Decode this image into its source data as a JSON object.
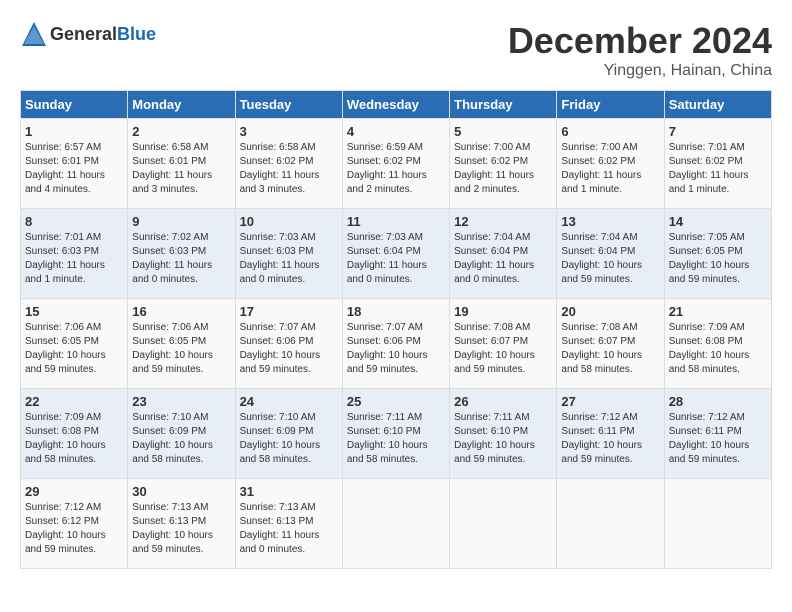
{
  "header": {
    "logo_general": "General",
    "logo_blue": "Blue",
    "title": "December 2024",
    "location": "Yinggen, Hainan, China"
  },
  "days_of_week": [
    "Sunday",
    "Monday",
    "Tuesday",
    "Wednesday",
    "Thursday",
    "Friday",
    "Saturday"
  ],
  "weeks": [
    [
      {
        "day": "1",
        "sunrise": "6:57 AM",
        "sunset": "6:01 PM",
        "daylight": "11 hours and 4 minutes."
      },
      {
        "day": "2",
        "sunrise": "6:58 AM",
        "sunset": "6:01 PM",
        "daylight": "11 hours and 3 minutes."
      },
      {
        "day": "3",
        "sunrise": "6:58 AM",
        "sunset": "6:02 PM",
        "daylight": "11 hours and 3 minutes."
      },
      {
        "day": "4",
        "sunrise": "6:59 AM",
        "sunset": "6:02 PM",
        "daylight": "11 hours and 2 minutes."
      },
      {
        "day": "5",
        "sunrise": "7:00 AM",
        "sunset": "6:02 PM",
        "daylight": "11 hours and 2 minutes."
      },
      {
        "day": "6",
        "sunrise": "7:00 AM",
        "sunset": "6:02 PM",
        "daylight": "11 hours and 1 minute."
      },
      {
        "day": "7",
        "sunrise": "7:01 AM",
        "sunset": "6:02 PM",
        "daylight": "11 hours and 1 minute."
      }
    ],
    [
      {
        "day": "8",
        "sunrise": "7:01 AM",
        "sunset": "6:03 PM",
        "daylight": "11 hours and 1 minute."
      },
      {
        "day": "9",
        "sunrise": "7:02 AM",
        "sunset": "6:03 PM",
        "daylight": "11 hours and 0 minutes."
      },
      {
        "day": "10",
        "sunrise": "7:03 AM",
        "sunset": "6:03 PM",
        "daylight": "11 hours and 0 minutes."
      },
      {
        "day": "11",
        "sunrise": "7:03 AM",
        "sunset": "6:04 PM",
        "daylight": "11 hours and 0 minutes."
      },
      {
        "day": "12",
        "sunrise": "7:04 AM",
        "sunset": "6:04 PM",
        "daylight": "11 hours and 0 minutes."
      },
      {
        "day": "13",
        "sunrise": "7:04 AM",
        "sunset": "6:04 PM",
        "daylight": "10 hours and 59 minutes."
      },
      {
        "day": "14",
        "sunrise": "7:05 AM",
        "sunset": "6:05 PM",
        "daylight": "10 hours and 59 minutes."
      }
    ],
    [
      {
        "day": "15",
        "sunrise": "7:06 AM",
        "sunset": "6:05 PM",
        "daylight": "10 hours and 59 minutes."
      },
      {
        "day": "16",
        "sunrise": "7:06 AM",
        "sunset": "6:05 PM",
        "daylight": "10 hours and 59 minutes."
      },
      {
        "day": "17",
        "sunrise": "7:07 AM",
        "sunset": "6:06 PM",
        "daylight": "10 hours and 59 minutes."
      },
      {
        "day": "18",
        "sunrise": "7:07 AM",
        "sunset": "6:06 PM",
        "daylight": "10 hours and 59 minutes."
      },
      {
        "day": "19",
        "sunrise": "7:08 AM",
        "sunset": "6:07 PM",
        "daylight": "10 hours and 59 minutes."
      },
      {
        "day": "20",
        "sunrise": "7:08 AM",
        "sunset": "6:07 PM",
        "daylight": "10 hours and 58 minutes."
      },
      {
        "day": "21",
        "sunrise": "7:09 AM",
        "sunset": "6:08 PM",
        "daylight": "10 hours and 58 minutes."
      }
    ],
    [
      {
        "day": "22",
        "sunrise": "7:09 AM",
        "sunset": "6:08 PM",
        "daylight": "10 hours and 58 minutes."
      },
      {
        "day": "23",
        "sunrise": "7:10 AM",
        "sunset": "6:09 PM",
        "daylight": "10 hours and 58 minutes."
      },
      {
        "day": "24",
        "sunrise": "7:10 AM",
        "sunset": "6:09 PM",
        "daylight": "10 hours and 58 minutes."
      },
      {
        "day": "25",
        "sunrise": "7:11 AM",
        "sunset": "6:10 PM",
        "daylight": "10 hours and 58 minutes."
      },
      {
        "day": "26",
        "sunrise": "7:11 AM",
        "sunset": "6:10 PM",
        "daylight": "10 hours and 59 minutes."
      },
      {
        "day": "27",
        "sunrise": "7:12 AM",
        "sunset": "6:11 PM",
        "daylight": "10 hours and 59 minutes."
      },
      {
        "day": "28",
        "sunrise": "7:12 AM",
        "sunset": "6:11 PM",
        "daylight": "10 hours and 59 minutes."
      }
    ],
    [
      {
        "day": "29",
        "sunrise": "7:12 AM",
        "sunset": "6:12 PM",
        "daylight": "10 hours and 59 minutes."
      },
      {
        "day": "30",
        "sunrise": "7:13 AM",
        "sunset": "6:13 PM",
        "daylight": "10 hours and 59 minutes."
      },
      {
        "day": "31",
        "sunrise": "7:13 AM",
        "sunset": "6:13 PM",
        "daylight": "11 hours and 0 minutes."
      },
      {
        "day": "",
        "sunrise": "",
        "sunset": "",
        "daylight": ""
      },
      {
        "day": "",
        "sunrise": "",
        "sunset": "",
        "daylight": ""
      },
      {
        "day": "",
        "sunrise": "",
        "sunset": "",
        "daylight": ""
      },
      {
        "day": "",
        "sunrise": "",
        "sunset": "",
        "daylight": ""
      }
    ]
  ]
}
